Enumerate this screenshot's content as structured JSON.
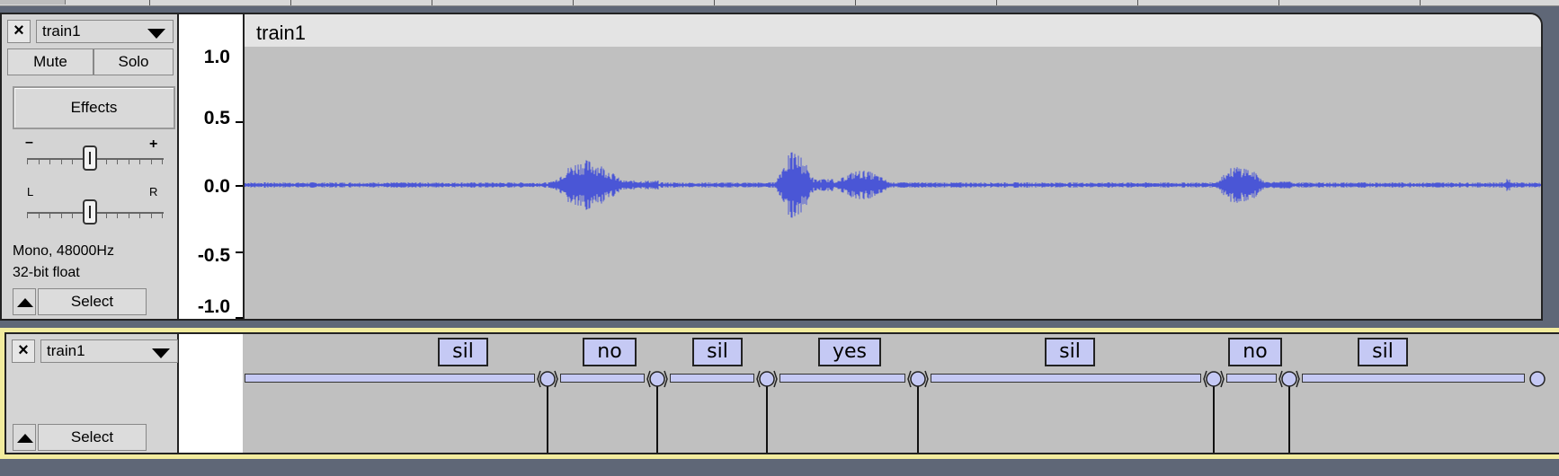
{
  "audio_track": {
    "name": "train1",
    "mute_label": "Mute",
    "solo_label": "Solo",
    "effects_label": "Effects",
    "gain_minus": "–",
    "gain_plus": "+",
    "pan_left": "L",
    "pan_right": "R",
    "format_line1": "Mono, 48000Hz",
    "format_line2": "32-bit float",
    "select_label": "Select",
    "clip_title": "train1",
    "y_axis": [
      "1.0",
      "0.5",
      "0.0",
      "-0.5",
      "-1.0"
    ],
    "gain_level": 0.5,
    "pan_level": 0.5,
    "colors": {
      "waveform": "#4a56d6",
      "background": "#c0c0c0"
    }
  },
  "label_track": {
    "name": "train1",
    "select_label": "Select",
    "labels": [
      {
        "text": "sil"
      },
      {
        "text": "no"
      },
      {
        "text": "sil"
      },
      {
        "text": "yes"
      },
      {
        "text": "sil"
      },
      {
        "text": "no"
      },
      {
        "text": "sil"
      }
    ],
    "colors": {
      "label_fill": "#c5c9f4",
      "track_highlight": "#f2ec9e"
    }
  },
  "icons": {
    "close": "close-icon",
    "track_menu": "chevron-down-icon",
    "collapse": "collapse-up-icon"
  }
}
